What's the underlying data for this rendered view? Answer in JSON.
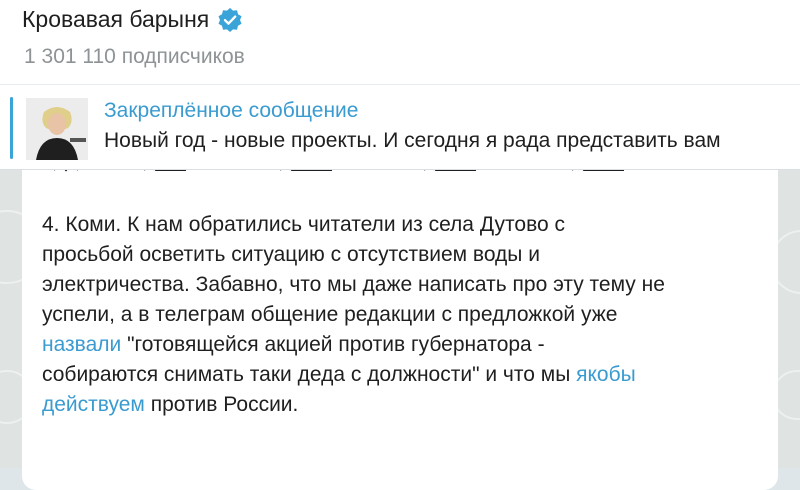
{
  "header": {
    "channel_title": "Кровавая барыня",
    "subscribers": "1 301 110 подписчиков",
    "verified_icon": "verified-badge-icon",
    "accent_color": "#3aa3d8"
  },
  "pinned": {
    "label": "Закреплённое сообщение",
    "text": "Новый год - новые проекты. И сегодня я рада представить вам"
  },
  "message": {
    "cut_top_line": "...",
    "line1": "4.  Коми. К нам обратились читатели из села Дутово с",
    "line2": "просьбой осветить ситуацию с отсутствием воды и",
    "line3": "электричества. Забавно, что мы даже написать про эту тему не",
    "line4": "успели, а в телеграм общение редакции с предложкой уже",
    "line5_link": "назвали",
    "line5_rest": " \"готовящейся акцией против губернатора -",
    "line6_pre": "собираются снимать таки деда с должности\" и что мы ",
    "line6_link": "якобы",
    "line7_link": "действуем",
    "line7_rest": " против России."
  }
}
